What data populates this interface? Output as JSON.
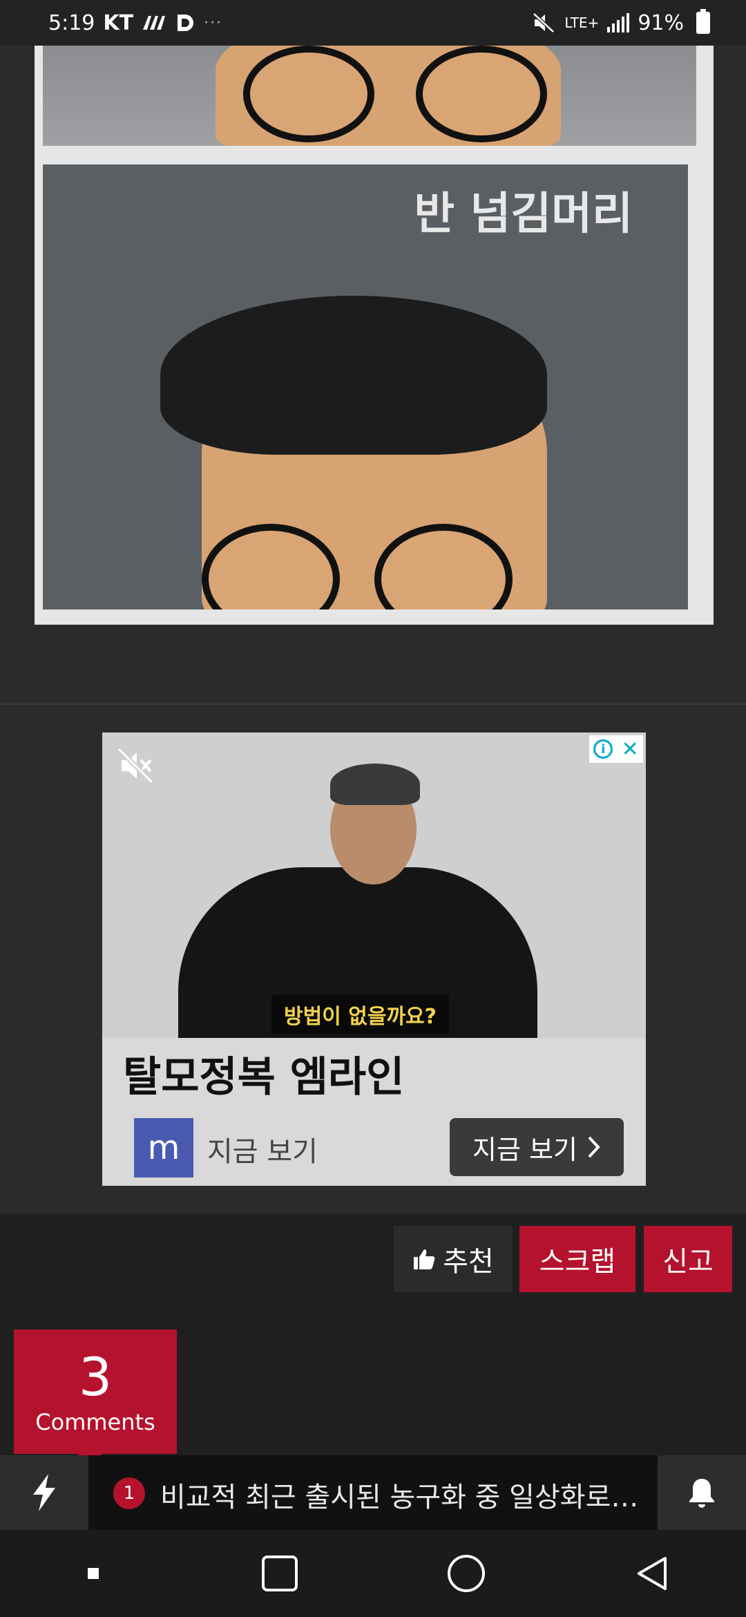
{
  "status_bar": {
    "time": "5:19",
    "carrier": "KT",
    "dots": "···",
    "network": "LTE+",
    "battery": "91%"
  },
  "article": {
    "photo_caption": "반 넘김머리"
  },
  "ad": {
    "subtitle": "방법이 없을까요?",
    "headline": "탈모정복 엠라인",
    "logo_letter": "m",
    "logo_text": "지금 보기",
    "cta_label": "지금 보기",
    "info_symbol": "i",
    "close_symbol": "✕"
  },
  "actions": {
    "recommend_label": "추천",
    "scrap_label": "스크랩",
    "report_label": "신고"
  },
  "comments": {
    "count": "3",
    "label": "Comments"
  },
  "ticker": {
    "badge": "1",
    "text": "비교적 최근 출시된 농구화 중 일상화로 겸..."
  },
  "colors": {
    "accent": "#b5122d",
    "background": "#2b2b2b",
    "dark_band": "#1f1f1f"
  }
}
